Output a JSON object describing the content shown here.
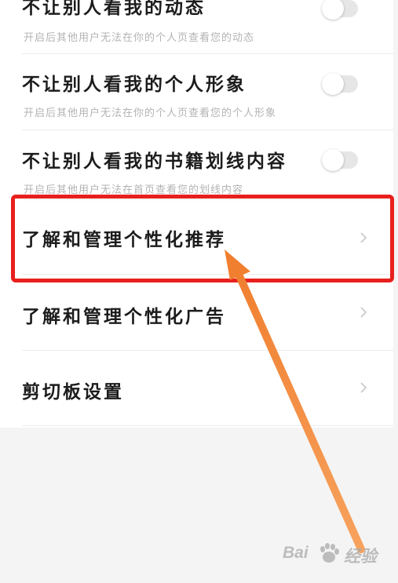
{
  "settings": {
    "items": [
      {
        "title": "不让别人看我的动态",
        "subtitle": "开启后其他用户无法在你的个人页查看您的动态",
        "type": "toggle",
        "on": false
      },
      {
        "title": "不让别人看我的个人形象",
        "subtitle": "开启后其他用户无法在你的个人页查看您的个人形象",
        "type": "toggle",
        "on": false
      },
      {
        "title": "不让别人看我的书籍划线内容",
        "subtitle": "开启后其他用户无法在首页查看您的划线内容",
        "type": "toggle",
        "on": false
      },
      {
        "title": "了解和管理个性化推荐",
        "type": "link",
        "icon": "chevron-right-icon"
      },
      {
        "title": "了解和管理个性化广告",
        "type": "link",
        "icon": "chevron-right-icon"
      },
      {
        "title": "剪切板设置",
        "type": "link",
        "icon": "chevron-right-icon"
      }
    ]
  },
  "annotation": {
    "highlight_color": "#e8201d",
    "arrow_color": "#f28a3c",
    "highlighted_item": "了解和管理个性化推荐"
  },
  "watermark": {
    "text_left": "Bai",
    "text_right": "经验",
    "icon": "baidu-paw-icon"
  }
}
